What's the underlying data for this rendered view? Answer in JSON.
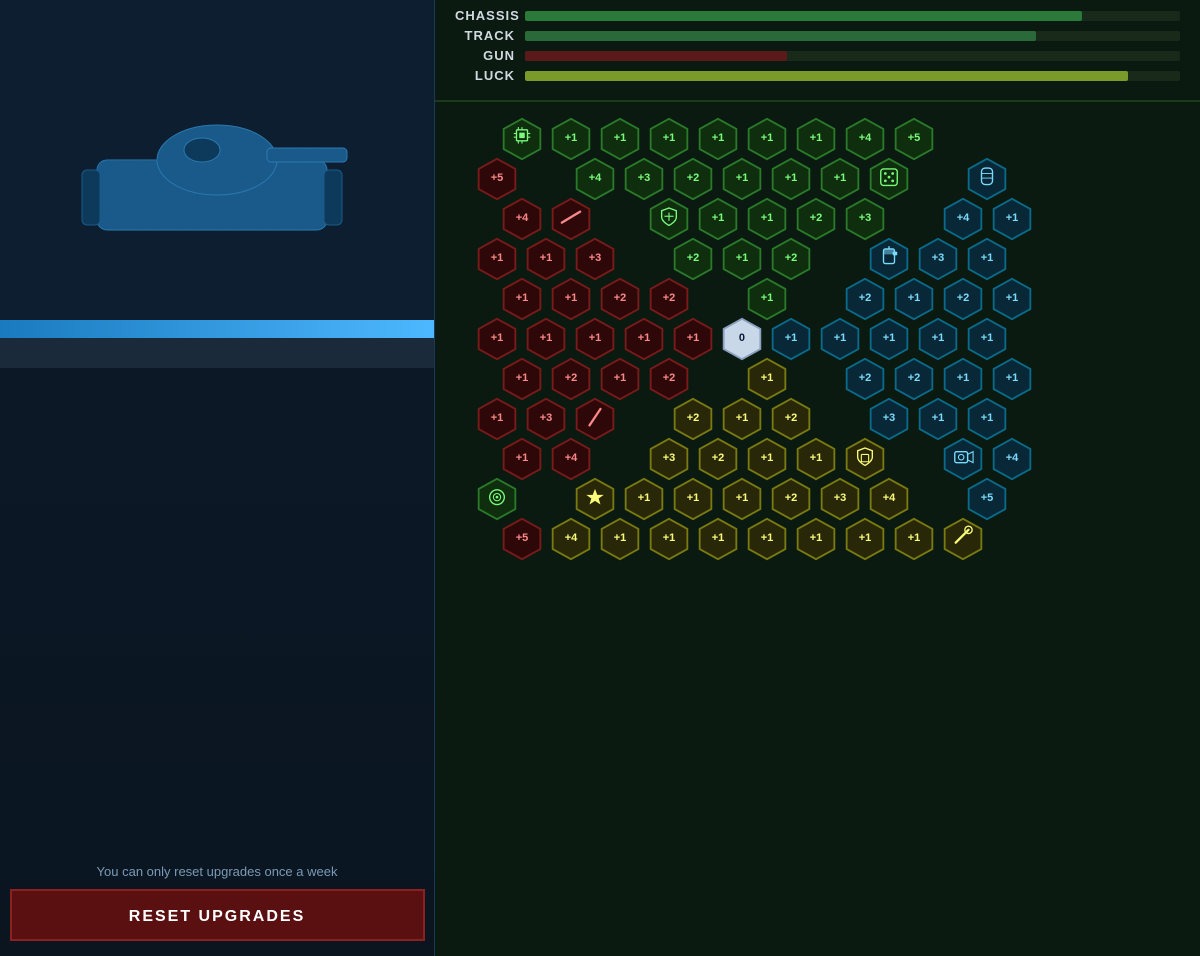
{
  "left_panel": {
    "reset_notice": "You can only reset upgrades once a week",
    "reset_button_label": "RESET UPGRADES"
  },
  "stats": [
    {
      "id": "chassis",
      "label": "CHASSIS",
      "fill_pct": 85,
      "color": "#2a7a3a"
    },
    {
      "id": "track",
      "label": "TRACK",
      "fill_pct": 78,
      "color": "#2a6a3a"
    },
    {
      "id": "gun",
      "label": "GUN",
      "fill_pct": 38,
      "color": "#6a1a1a"
    },
    {
      "id": "luck",
      "label": "LUCK",
      "fill_pct": 93,
      "color": "#7a9a2a"
    }
  ],
  "center_hex": "0",
  "colors": {
    "bg": "#0d1a2a",
    "panel_bg": "#0a1520",
    "grid_bg": "#0a1a10",
    "hex_green_bg": "#0d2a0d",
    "hex_green_border": "#2a8a2a",
    "hex_red_bg": "#3a0808",
    "hex_red_border": "#6a1010",
    "hex_teal_bg": "#082838",
    "hex_teal_border": "#0a6a7a",
    "hex_yellow_bg": "#282808",
    "hex_yellow_border": "#6a6a10",
    "hex_white_bg": "#d0d8e8",
    "hex_white_border": "#a0b0c8",
    "blue_bar": "#1a7abf",
    "reset_btn_bg": "#5a1010",
    "reset_btn_border": "#8a2020"
  }
}
